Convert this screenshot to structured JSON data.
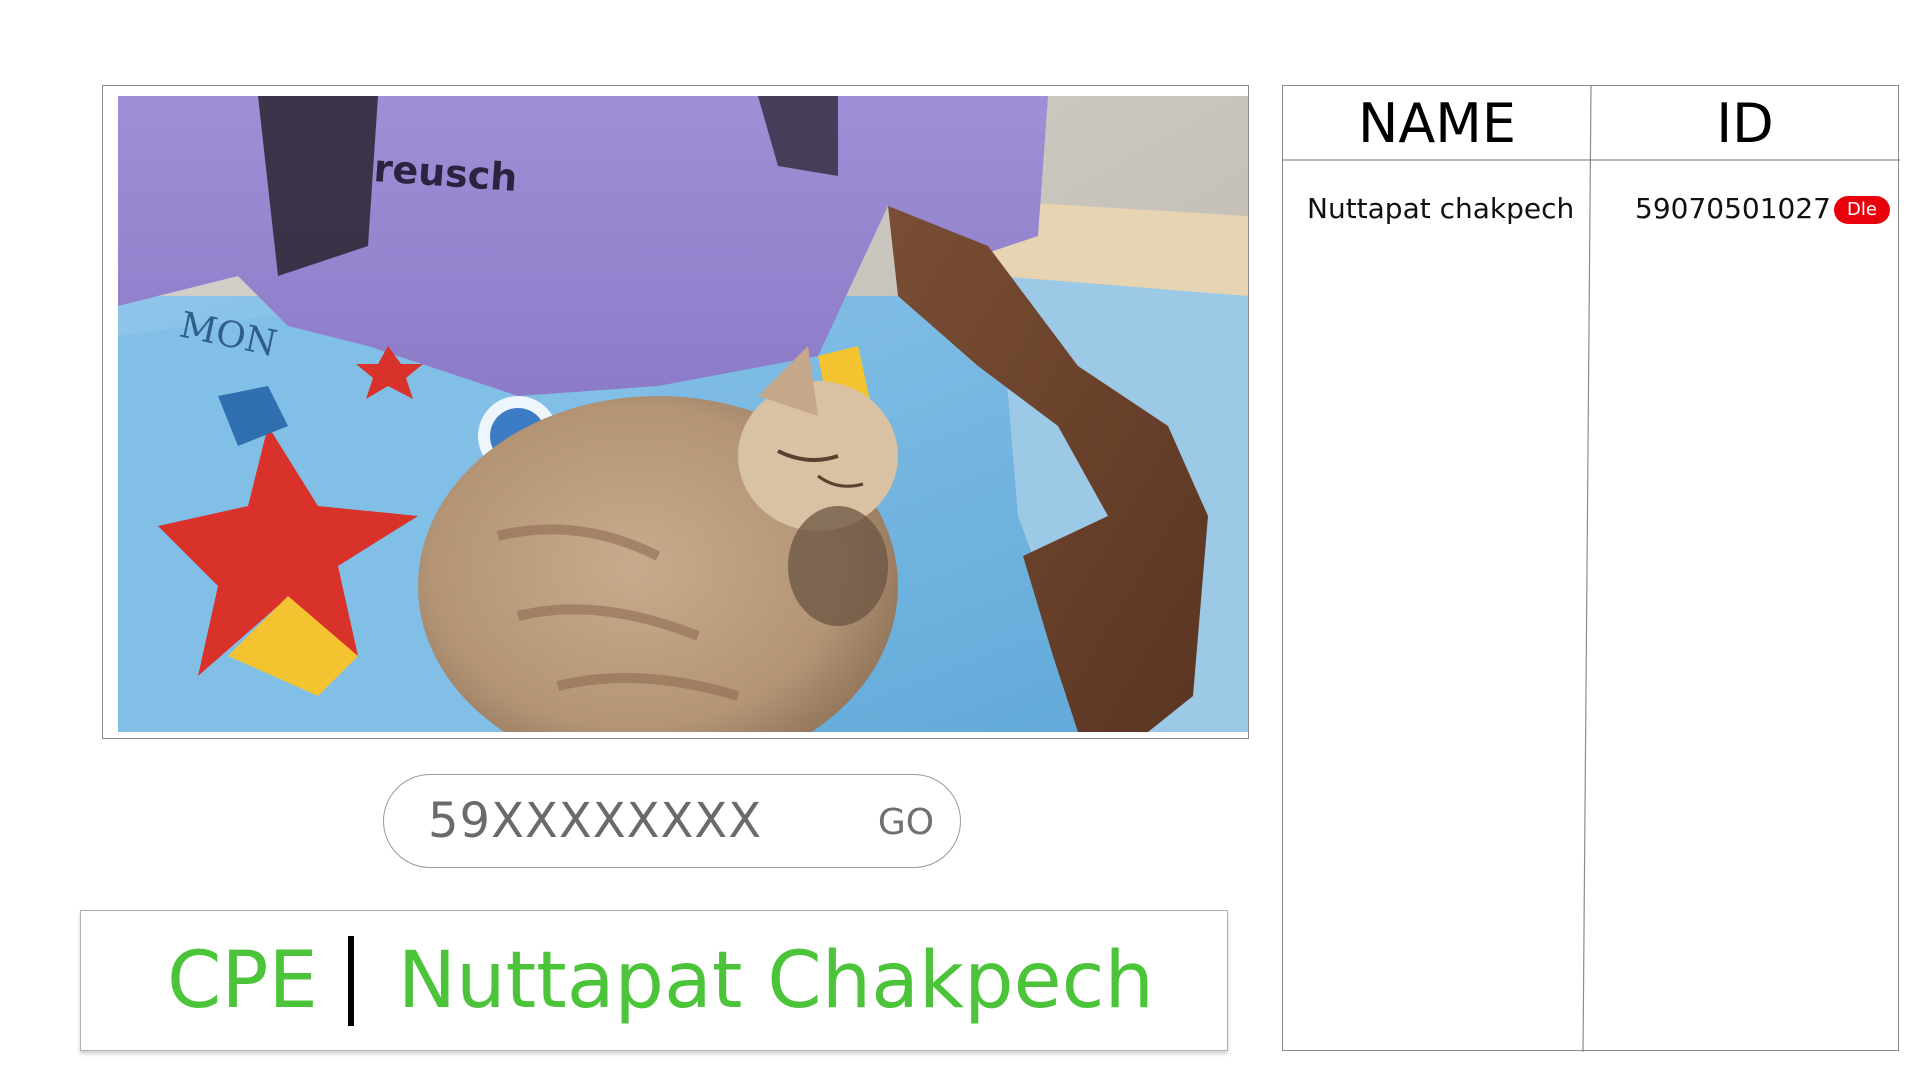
{
  "camera": {
    "description_icon": "webcam-feed"
  },
  "id_entry": {
    "placeholder": "59XXXXXXXX",
    "value": "",
    "go_label": "GO"
  },
  "banner": {
    "department": "CPE",
    "separator": "|",
    "name": "Nuttapat Chakpech",
    "text_color": "#4cc43a"
  },
  "table": {
    "columns": [
      "NAME",
      "ID"
    ],
    "rows": [
      {
        "name": "Nuttapat chakpech",
        "id": "59070501027",
        "action_label": "Dle",
        "action_color": "#e8000b"
      }
    ]
  }
}
